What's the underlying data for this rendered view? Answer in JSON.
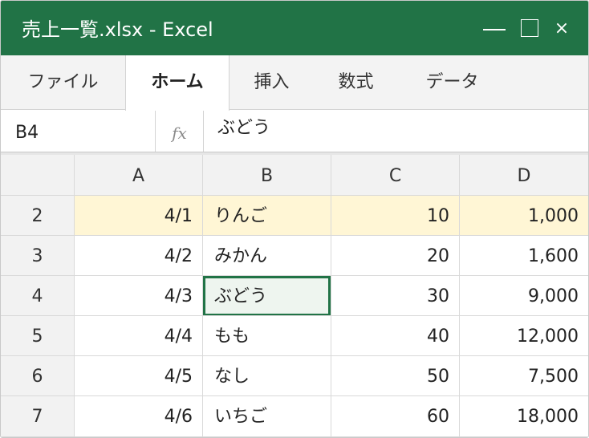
{
  "window": {
    "title": "売上一覧.xlsx - Excel"
  },
  "controls": {
    "minimize_symbol": "—",
    "close_symbol": "×"
  },
  "ribbon": {
    "tabs": [
      {
        "label": "ファイル"
      },
      {
        "label": "ホーム",
        "active": true
      },
      {
        "label": "挿入"
      },
      {
        "label": "数式"
      },
      {
        "label": "データ"
      }
    ]
  },
  "formula_bar": {
    "cell_ref": "B4",
    "fx_label": "fx",
    "value": "ぶどう"
  },
  "sheet": {
    "columns": [
      "A",
      "B",
      "C",
      "D"
    ],
    "rows": [
      {
        "num": "2",
        "a": "4/1",
        "b": "りんご",
        "c": "10",
        "d": "1,000",
        "highlight": true
      },
      {
        "num": "3",
        "a": "4/2",
        "b": "みかん",
        "c": "20",
        "d": "1,600"
      },
      {
        "num": "4",
        "a": "4/3",
        "b": "ぶどう",
        "c": "30",
        "d": "9,000"
      },
      {
        "num": "5",
        "a": "4/4",
        "b": "もも",
        "c": "40",
        "d": "12,000"
      },
      {
        "num": "6",
        "a": "4/5",
        "b": "なし",
        "c": "50",
        "d": "7,500"
      },
      {
        "num": "7",
        "a": "4/6",
        "b": "いちご",
        "c": "60",
        "d": "18,000"
      }
    ],
    "selected_cell": "B4",
    "colors": {
      "accent": "#217346",
      "highlight_row": "#fff6d5",
      "header_bg": "#f2f2f2"
    }
  }
}
